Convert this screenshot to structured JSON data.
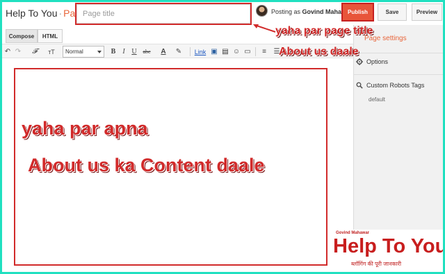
{
  "header": {
    "brand": "Help To You",
    "separator": "·",
    "crumb": "Page",
    "title_placeholder": "Page title",
    "posting_prefix": "Posting as",
    "posting_user": "Govind Mahawar",
    "publish_label": "Publish",
    "save_label": "Save",
    "preview_label": "Preview"
  },
  "mode_tabs": {
    "compose": "Compose",
    "html": "HTML"
  },
  "toolbar": {
    "undo_icon": "↶",
    "redo_icon": "↷",
    "font_icon": "𝓕",
    "size_icon": "тT",
    "format_value": "Normal",
    "bold": "B",
    "italic": "I",
    "underline": "U",
    "strike": "abc",
    "text_color": "A",
    "highlight": "✎",
    "link": "Link",
    "image_icon": "▣",
    "video_icon": "▤",
    "emoji_icon": "☺",
    "jump_icon": "▭",
    "align_icon": "≡",
    "list_icon": "☰"
  },
  "editor": {
    "line1": "yaha par apna",
    "line2": "About us ka Content daale"
  },
  "sidebar": {
    "page_settings": "Page settings",
    "options": "Options",
    "custom_robots": "Custom Robots Tags",
    "default": "default"
  },
  "annotations": {
    "line1": "yaha par page title",
    "line2": "About us daale"
  },
  "logo": {
    "small": "Govind Mahawar",
    "main": "Help To You",
    "sub": "ब्लॉगिंग की पूरी जानकारी"
  },
  "colors": {
    "accent": "#e8653a",
    "publish": "#e8553a",
    "annotation": "#d12a2a",
    "frame": "#20e0c0"
  }
}
